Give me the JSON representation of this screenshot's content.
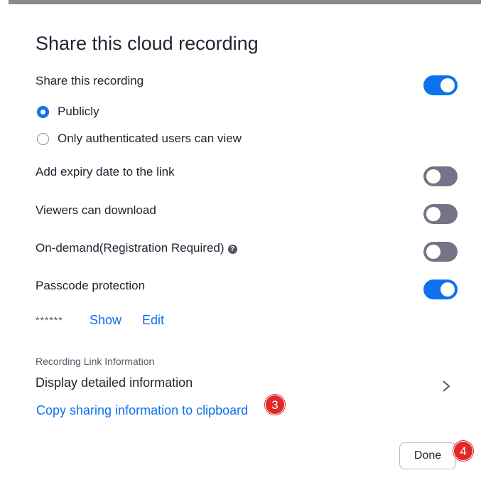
{
  "dialog": {
    "title": "Share this cloud recording",
    "share_label": "Share this recording",
    "share_on": true,
    "visibility_options": [
      {
        "label": "Publicly",
        "selected": true
      },
      {
        "label": "Only authenticated users can view",
        "selected": false
      }
    ],
    "settings": [
      {
        "label": "Add expiry date to the link",
        "on": false
      },
      {
        "label": "Viewers can download",
        "on": false
      },
      {
        "label": "On-demand(Registration Required)",
        "on": false,
        "help_icon": "?"
      },
      {
        "label": "Passcode protection",
        "on": true
      }
    ],
    "passcode": {
      "masked": "******",
      "show_label": "Show",
      "edit_label": "Edit"
    },
    "link_info": {
      "section_label": "Recording Link Information",
      "detail_label": "Display detailed information",
      "copy_label": "Copy sharing information to clipboard"
    },
    "done_label": "Done"
  },
  "annotations": {
    "badge_copy": "3",
    "badge_done": "4"
  },
  "colors": {
    "accent": "#0e72ed",
    "toggle_off": "#747487",
    "badge": "#e02828"
  }
}
